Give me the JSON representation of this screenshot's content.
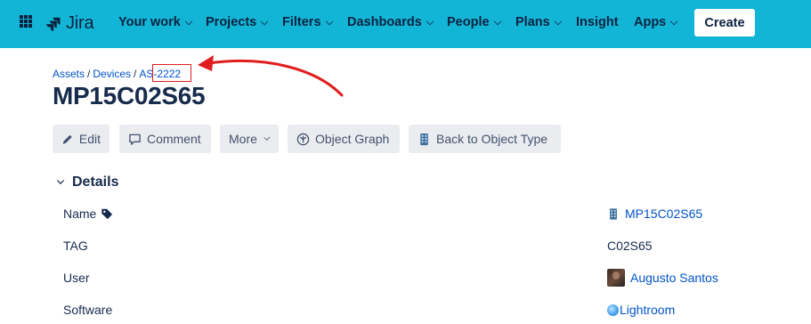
{
  "nav": {
    "app_name": "Jira",
    "items": [
      {
        "label": "Your work",
        "dropdown": true
      },
      {
        "label": "Projects",
        "dropdown": true
      },
      {
        "label": "Filters",
        "dropdown": true
      },
      {
        "label": "Dashboards",
        "dropdown": true
      },
      {
        "label": "People",
        "dropdown": true
      },
      {
        "label": "Plans",
        "dropdown": true
      },
      {
        "label": "Insight",
        "dropdown": false
      },
      {
        "label": "Apps",
        "dropdown": true
      }
    ],
    "create_label": "Create",
    "bar_color": "#13b5d6"
  },
  "breadcrumb": {
    "items": [
      "Assets",
      "Devices",
      "AS-2222"
    ],
    "separator": "/",
    "highlight_color": "#e01e1e"
  },
  "page_title": "MP15C02S65",
  "toolbar": {
    "edit": "Edit",
    "comment": "Comment",
    "more": "More",
    "object_graph": "Object Graph",
    "back": "Back to Object Type"
  },
  "details": {
    "title": "Details",
    "rows": [
      {
        "label": "Name",
        "value": "MP15C02S65"
      },
      {
        "label": "TAG",
        "value": "C02S65"
      },
      {
        "label": "User",
        "value": "Augusto Santos"
      },
      {
        "label": "Software",
        "value": "Lightroom"
      }
    ]
  }
}
